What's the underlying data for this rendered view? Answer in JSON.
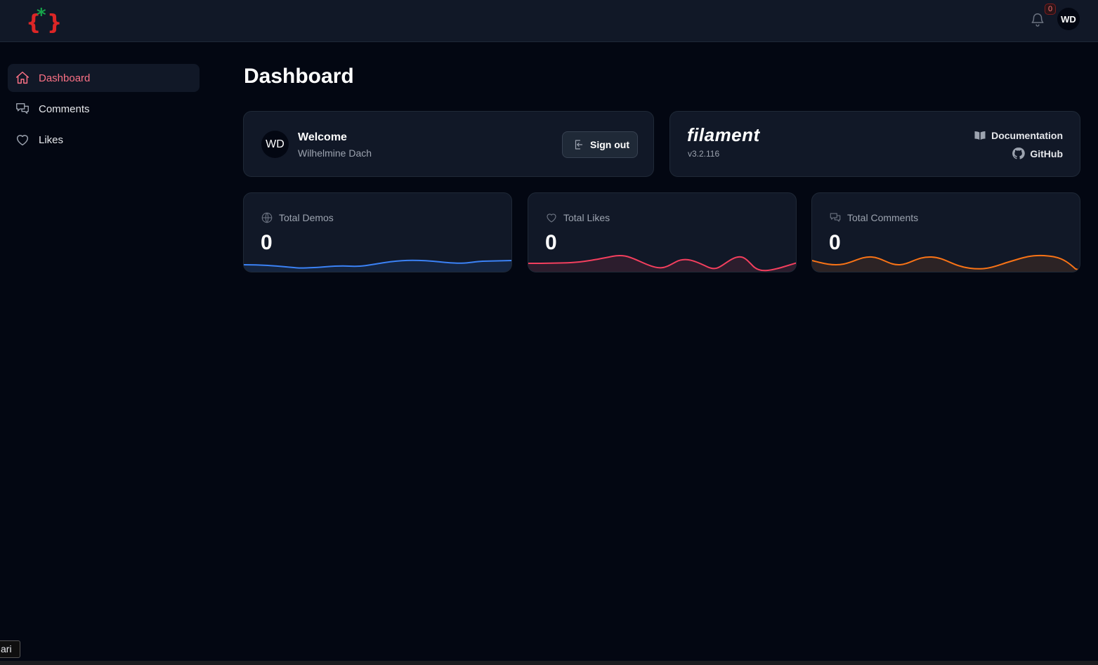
{
  "header": {
    "notifications": {
      "count": "0",
      "icon": "bell-icon"
    },
    "user_initials": "WD"
  },
  "sidebar": {
    "items": [
      {
        "label": "Dashboard",
        "icon": "home-icon",
        "active": true
      },
      {
        "label": "Comments",
        "icon": "chat-bubbles-icon",
        "active": false
      },
      {
        "label": "Likes",
        "icon": "heart-icon",
        "active": false
      }
    ]
  },
  "main": {
    "title": "Dashboard",
    "welcome": {
      "avatar_initials": "WD",
      "title": "Welcome",
      "name": "Wilhelmine Dach",
      "signout_label": "Sign out"
    },
    "filament": {
      "logo": "filament",
      "version": "v3.2.116",
      "documentation_label": "Documentation",
      "github_label": "GitHub"
    },
    "stats": [
      {
        "label": "Total Demos",
        "value": "0",
        "icon": "globe-icon",
        "color": "#3b82f6"
      },
      {
        "label": "Total Likes",
        "value": "0",
        "icon": "heart-icon",
        "color": "#f43f5e"
      },
      {
        "label": "Total Comments",
        "value": "0",
        "icon": "chat-bubbles-icon",
        "color": "#f97316"
      }
    ]
  },
  "tooltip": "ari",
  "colors": {
    "background": "#030712",
    "surface": "#111827",
    "accent": "#fb7185",
    "logo_red": "#dc2626",
    "logo_green": "#16a34a"
  }
}
